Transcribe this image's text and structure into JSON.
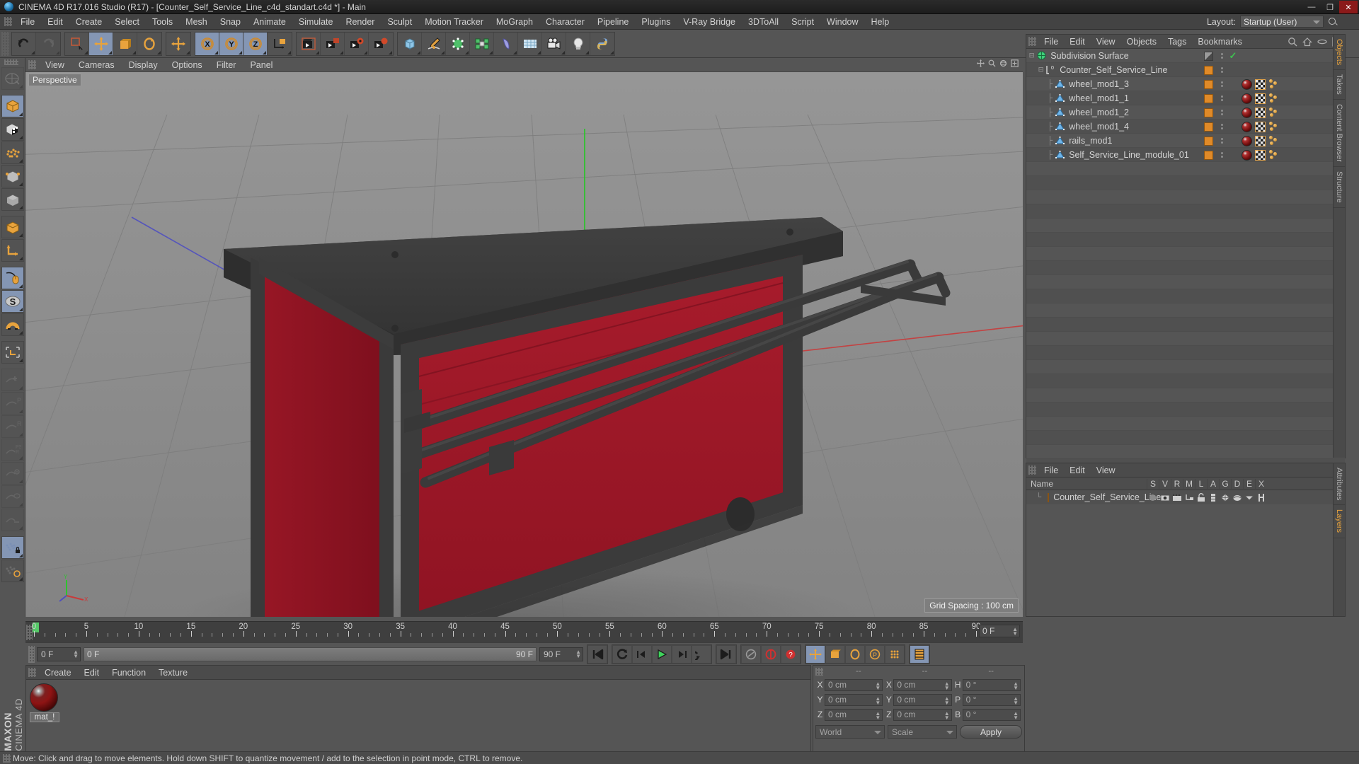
{
  "window": {
    "title": "CINEMA 4D R17.016 Studio (R17) - [Counter_Self_Service_Line_c4d_standart.c4d *] - Main",
    "minimize": "—",
    "maximize": "❐",
    "close": "✕"
  },
  "menubar": {
    "items": [
      "File",
      "Edit",
      "Create",
      "Select",
      "Tools",
      "Mesh",
      "Snap",
      "Animate",
      "Simulate",
      "Render",
      "Sculpt",
      "Motion Tracker",
      "MoGraph",
      "Character",
      "Pipeline",
      "Plugins",
      "V-Ray Bridge",
      "3DToAll",
      "Script",
      "Window",
      "Help"
    ],
    "layout_label": "Layout:",
    "layout_value": "Startup (User)"
  },
  "viewport": {
    "menu": [
      "View",
      "Cameras",
      "Display",
      "Options",
      "Filter",
      "Panel"
    ],
    "view_label": "Perspective",
    "grid_spacing": "Grid Spacing : 100 cm"
  },
  "object_manager": {
    "menu": [
      "File",
      "Edit",
      "View",
      "Objects",
      "Tags",
      "Bookmarks"
    ],
    "rows": [
      {
        "name": "Subdivision Surface",
        "depth": 0,
        "icon": "subdivision-surface-icon",
        "swatch": "grey",
        "tags": [],
        "check": true
      },
      {
        "name": "Counter_Self_Service_Line",
        "depth": 1,
        "icon": "null-object-icon",
        "swatch": "orange",
        "tags": [],
        "check": false
      },
      {
        "name": "wheel_mod1_3",
        "depth": 2,
        "icon": "polygon-object-icon",
        "swatch": "orange",
        "tags": [
          "material",
          "uvw",
          "phong"
        ],
        "check": false
      },
      {
        "name": "wheel_mod1_1",
        "depth": 2,
        "icon": "polygon-object-icon",
        "swatch": "orange",
        "tags": [
          "material",
          "uvw",
          "phong"
        ],
        "check": false
      },
      {
        "name": "wheel_mod1_2",
        "depth": 2,
        "icon": "polygon-object-icon",
        "swatch": "orange",
        "tags": [
          "material",
          "uvw",
          "phong"
        ],
        "check": false
      },
      {
        "name": "wheel_mod1_4",
        "depth": 2,
        "icon": "polygon-object-icon",
        "swatch": "orange",
        "tags": [
          "material",
          "uvw",
          "phong"
        ],
        "check": false
      },
      {
        "name": "rails_mod1",
        "depth": 2,
        "icon": "polygon-object-icon",
        "swatch": "orange",
        "tags": [
          "material",
          "uvw",
          "phong"
        ],
        "check": false
      },
      {
        "name": "Self_Service_Line_module_01",
        "depth": 2,
        "icon": "polygon-object-icon",
        "swatch": "orange",
        "tags": [
          "material",
          "uvw",
          "phong"
        ],
        "check": false
      }
    ],
    "side_tabs": [
      "Objects",
      "Takes",
      "Content Browser",
      "Structure"
    ]
  },
  "attribute_manager": {
    "menu": [
      "File",
      "Edit",
      "View"
    ],
    "columns": [
      "Name",
      "S",
      "V",
      "R",
      "M",
      "L",
      "A",
      "G",
      "D",
      "E",
      "X"
    ],
    "rows": [
      {
        "name": "Counter_Self_Service_Line",
        "swatch": "orange"
      }
    ],
    "side_tabs": [
      "Attributes",
      "Layers"
    ]
  },
  "timeline": {
    "ticks": [
      0,
      5,
      10,
      15,
      20,
      25,
      30,
      35,
      40,
      45,
      50,
      55,
      60,
      65,
      70,
      75,
      80,
      85,
      90
    ],
    "range_start": 0,
    "range_end": 90,
    "end_field": "0 F"
  },
  "playback": {
    "current_frame": "0 F",
    "slider_left": "0 F",
    "slider_right": "90 F",
    "max_frame": "90 F",
    "buttons": [
      "go-to-start",
      "play-reverse",
      "step-back",
      "play",
      "step-forward",
      "loop",
      "go-to-end",
      "record-active-objects",
      "autokey",
      "keyframe-selection",
      "position",
      "scale",
      "rotation",
      "parameter",
      "point-level-animation",
      "timeline"
    ]
  },
  "coordinates": {
    "headers": [
      "--",
      "--",
      "--"
    ],
    "rows": [
      {
        "label1": "X",
        "value1": "0 cm",
        "label2": "X",
        "value2": "0 cm",
        "label3": "H",
        "value3": "0 °"
      },
      {
        "label1": "Y",
        "value1": "0 cm",
        "label2": "Y",
        "value2": "0 cm",
        "label3": "P",
        "value3": "0 °"
      },
      {
        "label1": "Z",
        "value1": "0 cm",
        "label2": "Z",
        "value2": "0 cm",
        "label3": "B",
        "value3": "0 °"
      }
    ],
    "system": "World",
    "mode": "Scale",
    "apply": "Apply"
  },
  "material_manager": {
    "menu": [
      "Create",
      "Edit",
      "Function",
      "Texture"
    ],
    "materials": [
      {
        "name": "mat_!",
        "color": "#8e1414"
      }
    ]
  },
  "brand": {
    "line1": "MAXON",
    "line2": "CINEMA 4D"
  },
  "status": {
    "message": "Move: Click and drag to move elements. Hold down SHIFT to quantize movement / add to the selection in point mode, CTRL to remove."
  },
  "toolbar": {
    "groups": [
      {
        "buttons": [
          {
            "name": "undo-button",
            "icon": "undo",
            "selected": false
          },
          {
            "name": "redo-button",
            "icon": "redo",
            "selected": false,
            "dim": true
          }
        ]
      },
      {
        "buttons": [
          {
            "name": "live-selection-tool",
            "icon": "select",
            "selected": false
          },
          {
            "name": "move-tool",
            "icon": "move",
            "selected": true
          },
          {
            "name": "scale-tool",
            "icon": "scale",
            "selected": false
          },
          {
            "name": "rotate-tool",
            "icon": "rotate",
            "selected": false
          }
        ]
      },
      {
        "buttons": [
          {
            "name": "move-axis-tool",
            "icon": "move",
            "selected": false
          }
        ]
      },
      {
        "buttons": [
          {
            "name": "lock-x-axis",
            "icon": "X",
            "selected": true
          },
          {
            "name": "lock-y-axis",
            "icon": "Y",
            "selected": true
          },
          {
            "name": "lock-z-axis",
            "icon": "Z",
            "selected": true
          },
          {
            "name": "world-object-coordinates",
            "icon": "axis",
            "selected": false
          }
        ]
      },
      {
        "buttons": [
          {
            "name": "render-view-button",
            "icon": "render-view",
            "selected": false
          },
          {
            "name": "render-to-picture-viewer-button",
            "icon": "render-pv",
            "selected": false
          },
          {
            "name": "render-region-button",
            "icon": "render-region",
            "selected": false
          },
          {
            "name": "render-settings-button",
            "icon": "render-settings",
            "selected": false
          }
        ]
      },
      {
        "buttons": [
          {
            "name": "primitive-cube-menu",
            "icon": "cube",
            "selected": false
          },
          {
            "name": "spline-pen-menu",
            "icon": "pen",
            "selected": false
          },
          {
            "name": "generator-menu",
            "icon": "generator",
            "selected": false
          },
          {
            "name": "mograph-menu",
            "icon": "mograph",
            "selected": false
          },
          {
            "name": "deformer-menu",
            "icon": "deformer",
            "selected": false
          },
          {
            "name": "environment-menu",
            "icon": "floor",
            "selected": false
          },
          {
            "name": "camera-menu",
            "icon": "camera",
            "selected": false
          },
          {
            "name": "light-menu",
            "icon": "light",
            "selected": false
          },
          {
            "name": "python-menu",
            "icon": "python",
            "selected": false
          }
        ]
      }
    ]
  },
  "left_palette": {
    "buttons": [
      {
        "name": "make-editable-button",
        "icon": "make-editable",
        "selected": false,
        "dim": true
      },
      {
        "name": "model-mode-button",
        "icon": "model",
        "selected": true
      },
      {
        "name": "texture-mode-button",
        "icon": "texture",
        "selected": false
      },
      {
        "name": "points-mode-button",
        "icon": "points",
        "selected": false
      },
      {
        "name": "edges-mode-button",
        "icon": "edges",
        "selected": false
      },
      {
        "name": "polygons-mode-button",
        "icon": "polygons",
        "selected": false
      },
      {
        "name": "object-axis-mode-button",
        "icon": "object-axis",
        "selected": false
      },
      {
        "name": "world-axis-button",
        "icon": "world-axis",
        "selected": false
      },
      {
        "name": "viewport-solo-button",
        "icon": "mouse",
        "selected": true
      },
      {
        "name": "soft-selection-button",
        "icon": "soft-select",
        "selected": true
      },
      {
        "name": "magnet-tool-button",
        "icon": "magnet",
        "selected": false
      },
      {
        "name": "axis-modification-button",
        "icon": "axis-mod",
        "selected": false
      },
      {
        "name": "enable-snap-button",
        "icon": "snap",
        "selected": false,
        "dim": true
      },
      {
        "name": "snap-position-button",
        "icon": "snap-p",
        "selected": false,
        "dim": true
      },
      {
        "name": "snap-rotation-button",
        "icon": "snap-r",
        "selected": false,
        "dim": true
      },
      {
        "name": "snap-psr-button",
        "icon": "snap-psr",
        "selected": false,
        "dim": true
      },
      {
        "name": "snap-point-button",
        "icon": "snap-point",
        "selected": false,
        "dim": true
      },
      {
        "name": "snap-edge-button",
        "icon": "snap-edge",
        "selected": false,
        "dim": true
      },
      {
        "name": "snap-spline-button",
        "icon": "snap-spline",
        "selected": false,
        "dim": true
      },
      {
        "name": "workplane-lock-button",
        "icon": "workplane-lock",
        "selected": true
      },
      {
        "name": "workplane-mode-button",
        "icon": "workplane-mode",
        "selected": false
      }
    ]
  },
  "scene": {
    "description": "3D perspective view of a red and dark-grey self-service counter module with rails and wheels"
  }
}
